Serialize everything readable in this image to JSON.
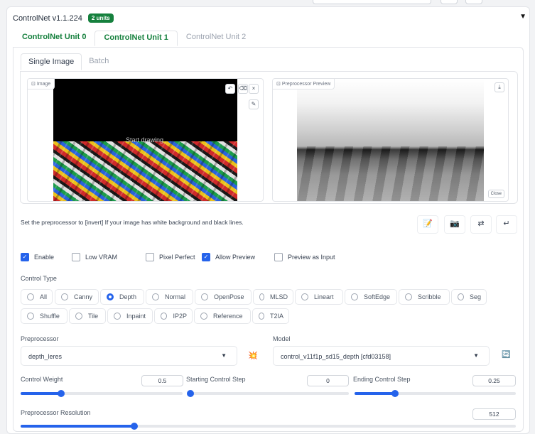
{
  "panel": {
    "title": "ControlNet v1.1.224",
    "units_badge": "2 units",
    "collapse_icon": "▼"
  },
  "unit_tabs": [
    "ControlNet Unit 0",
    "ControlNet Unit 1",
    "ControlNet Unit 2"
  ],
  "active_unit_tab": 1,
  "image_tabs": [
    "Single Image",
    "Batch"
  ],
  "image_box": {
    "label": "Image",
    "placeholder": "Start drawing"
  },
  "preview_box": {
    "label": "Preprocessor Preview",
    "close_label": "Close"
  },
  "hint": "Set the preprocessor to [invert] If your image has white background and black lines.",
  "toolbar_icons": [
    "📝",
    "📷",
    "⇄",
    "↵"
  ],
  "checkboxes": [
    {
      "label": "Enable",
      "checked": true
    },
    {
      "label": "Low VRAM",
      "checked": false
    },
    {
      "label": "Pixel Perfect",
      "checked": false
    },
    {
      "label": "Allow Preview",
      "checked": true
    },
    {
      "label": "Preview as Input",
      "checked": false
    }
  ],
  "control_type": {
    "label": "Control Type",
    "options": [
      "All",
      "Canny",
      "Depth",
      "Normal",
      "OpenPose",
      "MLSD",
      "Lineart",
      "SoftEdge",
      "Scribble",
      "Seg",
      "Shuffle",
      "Tile",
      "Inpaint",
      "IP2P",
      "Reference",
      "T2IA"
    ],
    "selected": "Depth"
  },
  "preprocessor": {
    "label": "Preprocessor",
    "value": "depth_leres",
    "run_icon": "💥"
  },
  "model": {
    "label": "Model",
    "value": "control_v11f1p_sd15_depth [cfd03158]",
    "refresh_icon": "🔄"
  },
  "sliders": {
    "control_weight": {
      "label": "Control Weight",
      "value": "0.5",
      "fraction": 0.25
    },
    "start_step": {
      "label": "Starting Control Step",
      "value": "0",
      "fraction": 0
    },
    "end_step": {
      "label": "Ending Control Step",
      "value": "0.25",
      "fraction": 0.25
    },
    "resolution": {
      "label": "Preprocessor Resolution",
      "value": "512",
      "fraction": 0.23
    }
  },
  "colors": {
    "accent": "#2563eb",
    "unit_green": "#15803d"
  }
}
